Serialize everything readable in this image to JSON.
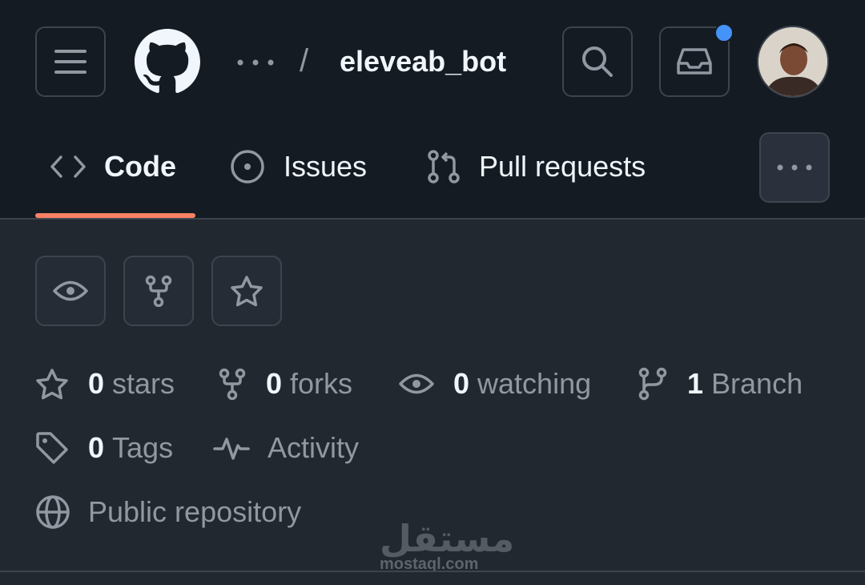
{
  "header": {
    "repo_name": "eleveab_bot",
    "crumb_separator": "/",
    "notification_dot_color": "#4493f8",
    "icons": [
      "menu-icon",
      "github-logo",
      "ellipsis-icon",
      "search-icon",
      "inbox-icon",
      "avatar"
    ]
  },
  "tabs": [
    {
      "label": "Code",
      "icon": "code-icon",
      "selected": true
    },
    {
      "label": "Issues",
      "icon": "issue-icon",
      "selected": false
    },
    {
      "label": "Pull requests",
      "icon": "pull-request-icon",
      "selected": false
    }
  ],
  "actions": [
    {
      "icon": "eye-icon"
    },
    {
      "icon": "fork-icon"
    },
    {
      "icon": "star-icon"
    }
  ],
  "stats": {
    "stars": {
      "count": "0",
      "label": "stars"
    },
    "forks": {
      "count": "0",
      "label": "forks"
    },
    "watching": {
      "count": "0",
      "label": "watching"
    },
    "branch": {
      "count": "1",
      "label": "Branch"
    },
    "tags": {
      "count": "0",
      "label": "Tags"
    },
    "activity": {
      "label": "Activity"
    },
    "visibility": {
      "label": "Public repository"
    }
  },
  "watermark": {
    "arabic": "مستقل",
    "latin": "mostaql.com"
  },
  "colors": {
    "header_bg": "#151b23",
    "body_bg": "#212830",
    "accent_underline": "#f78166",
    "muted_text": "#9198a1",
    "border": "#3d444d"
  }
}
